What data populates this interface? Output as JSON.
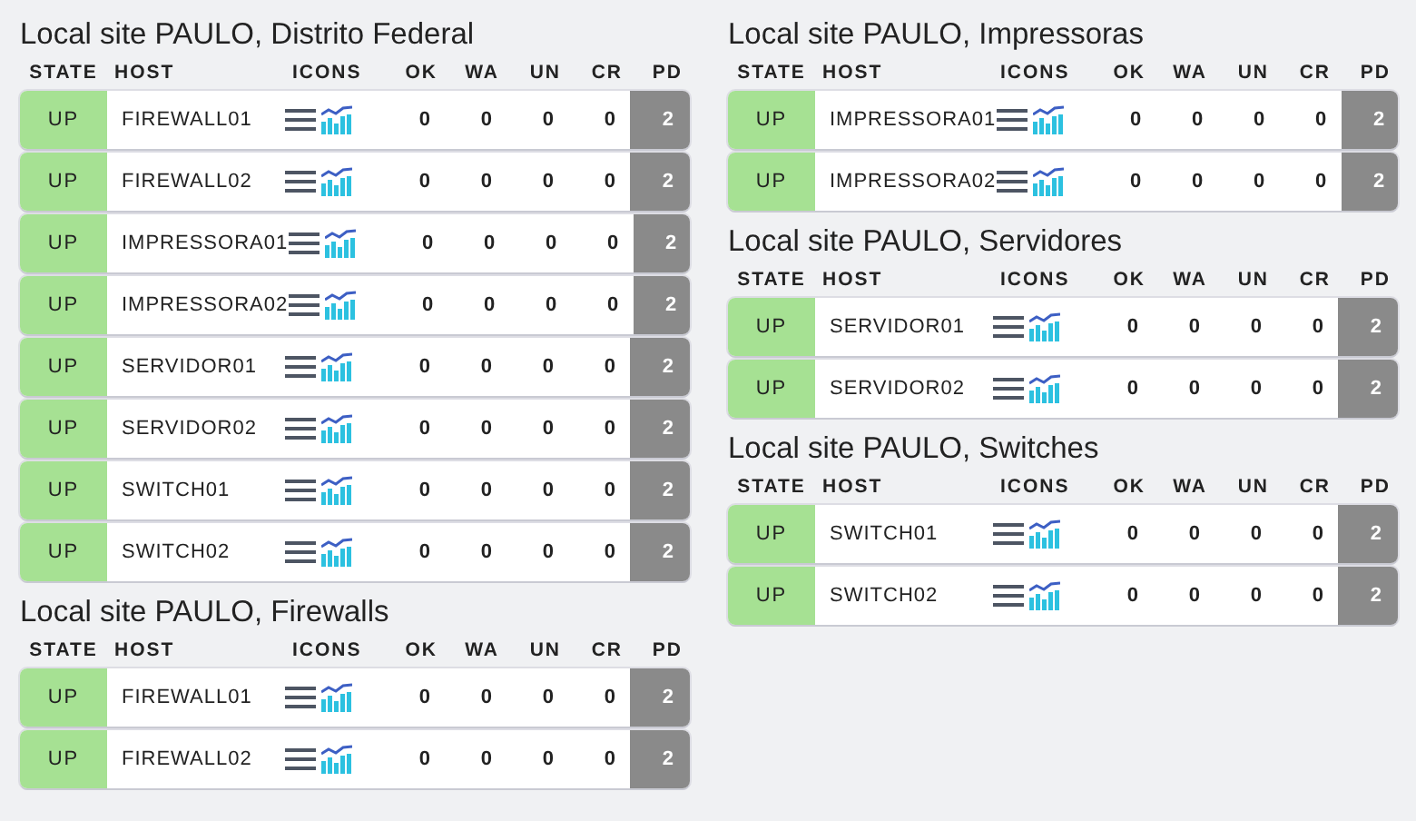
{
  "columns": [
    {
      "groups": [
        {
          "title": "Local site PAULO, Distrito Federal",
          "headers": [
            "STATE",
            "HOST",
            "ICONS",
            "OK",
            "WA",
            "UN",
            "CR",
            "PD"
          ],
          "rows": [
            {
              "state": "UP",
              "host": "FIREWALL01",
              "ok": "0",
              "wa": "0",
              "un": "0",
              "cr": "0",
              "pd": "2"
            },
            {
              "state": "UP",
              "host": "FIREWALL02",
              "ok": "0",
              "wa": "0",
              "un": "0",
              "cr": "0",
              "pd": "2"
            },
            {
              "state": "UP",
              "host": "IMPRESSORA01",
              "ok": "0",
              "wa": "0",
              "un": "0",
              "cr": "0",
              "pd": "2"
            },
            {
              "state": "UP",
              "host": "IMPRESSORA02",
              "ok": "0",
              "wa": "0",
              "un": "0",
              "cr": "0",
              "pd": "2"
            },
            {
              "state": "UP",
              "host": "SERVIDOR01",
              "ok": "0",
              "wa": "0",
              "un": "0",
              "cr": "0",
              "pd": "2"
            },
            {
              "state": "UP",
              "host": "SERVIDOR02",
              "ok": "0",
              "wa": "0",
              "un": "0",
              "cr": "0",
              "pd": "2"
            },
            {
              "state": "UP",
              "host": "SWITCH01",
              "ok": "0",
              "wa": "0",
              "un": "0",
              "cr": "0",
              "pd": "2"
            },
            {
              "state": "UP",
              "host": "SWITCH02",
              "ok": "0",
              "wa": "0",
              "un": "0",
              "cr": "0",
              "pd": "2"
            }
          ]
        },
        {
          "title": "Local site PAULO, Firewalls",
          "headers": [
            "STATE",
            "HOST",
            "ICONS",
            "OK",
            "WA",
            "UN",
            "CR",
            "PD"
          ],
          "rows": [
            {
              "state": "UP",
              "host": "FIREWALL01",
              "ok": "0",
              "wa": "0",
              "un": "0",
              "cr": "0",
              "pd": "2"
            },
            {
              "state": "UP",
              "host": "FIREWALL02",
              "ok": "0",
              "wa": "0",
              "un": "0",
              "cr": "0",
              "pd": "2"
            }
          ]
        }
      ]
    },
    {
      "groups": [
        {
          "title": "Local site PAULO, Impressoras",
          "headers": [
            "STATE",
            "HOST",
            "ICONS",
            "OK",
            "WA",
            "UN",
            "CR",
            "PD"
          ],
          "rows": [
            {
              "state": "UP",
              "host": "IMPRESSORA01",
              "ok": "0",
              "wa": "0",
              "un": "0",
              "cr": "0",
              "pd": "2"
            },
            {
              "state": "UP",
              "host": "IMPRESSORA02",
              "ok": "0",
              "wa": "0",
              "un": "0",
              "cr": "0",
              "pd": "2"
            }
          ]
        },
        {
          "title": "Local site PAULO, Servidores",
          "headers": [
            "STATE",
            "HOST",
            "ICONS",
            "OK",
            "WA",
            "UN",
            "CR",
            "PD"
          ],
          "rows": [
            {
              "state": "UP",
              "host": "SERVIDOR01",
              "ok": "0",
              "wa": "0",
              "un": "0",
              "cr": "0",
              "pd": "2"
            },
            {
              "state": "UP",
              "host": "SERVIDOR02",
              "ok": "0",
              "wa": "0",
              "un": "0",
              "cr": "0",
              "pd": "2"
            }
          ]
        },
        {
          "title": "Local site PAULO, Switches",
          "headers": [
            "STATE",
            "HOST",
            "ICONS",
            "OK",
            "WA",
            "UN",
            "CR",
            "PD"
          ],
          "rows": [
            {
              "state": "UP",
              "host": "SWITCH01",
              "ok": "0",
              "wa": "0",
              "un": "0",
              "cr": "0",
              "pd": "2"
            },
            {
              "state": "UP",
              "host": "SWITCH02",
              "ok": "0",
              "wa": "0",
              "un": "0",
              "cr": "0",
              "pd": "2"
            }
          ]
        }
      ]
    }
  ]
}
